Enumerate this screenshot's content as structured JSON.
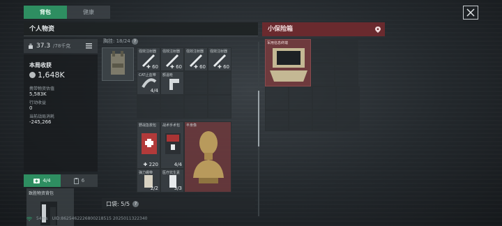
{
  "tabs": [
    {
      "label": "背包",
      "active": true
    },
    {
      "label": "健康",
      "active": false
    }
  ],
  "left": {
    "header": "个人物资",
    "weight_value": "37.3",
    "weight_max": "/78千克",
    "round_income_title": "本局收获",
    "round_income_value": "1,648K",
    "stats": [
      {
        "label": "携带物资估值",
        "value": "5,583K"
      },
      {
        "label": "行动收益",
        "value": "0"
      },
      {
        "label": "当前战局消耗",
        "value": "-245,266"
      }
    ],
    "sub_tabs": [
      {
        "label": "4/4",
        "icon": "first-aid-icon",
        "active": true
      },
      {
        "label": "6",
        "icon": "clipboard-icon",
        "active": false
      }
    ],
    "bag_card_label": "致胜物资背包"
  },
  "middle": {
    "capacity_label": "胸挂: 18/24",
    "grid_items": [
      {
        "name": "强效注射器",
        "count": "60"
      },
      {
        "name": "强效注射器",
        "count": "60"
      },
      {
        "name": "强效注射器",
        "count": "60"
      },
      {
        "name": "强效注射器",
        "count": "60"
      },
      {
        "name": "CAT止血带",
        "count": "4/4"
      },
      {
        "name": "额温枪",
        "count": ""
      },
      {
        "name": "野战急救包",
        "count": "220"
      },
      {
        "name": "战术手术包",
        "count": "4/4"
      },
      {
        "name": "半身像",
        "count": ""
      },
      {
        "name": "弹力绷带",
        "count": "2/2"
      },
      {
        "name": "医疗抗生素",
        "count": "3/3"
      }
    ],
    "pocket_label": "口袋: 5/5"
  },
  "right": {
    "header": "小保险箱",
    "item_name": "军用信息终端"
  },
  "footer": {
    "ping": "54ms",
    "session_id": "UID:8625462226800218515 2025011322340"
  },
  "colors": {
    "accent_green": "#2e8e61",
    "container_red": "#6a2a2e"
  }
}
